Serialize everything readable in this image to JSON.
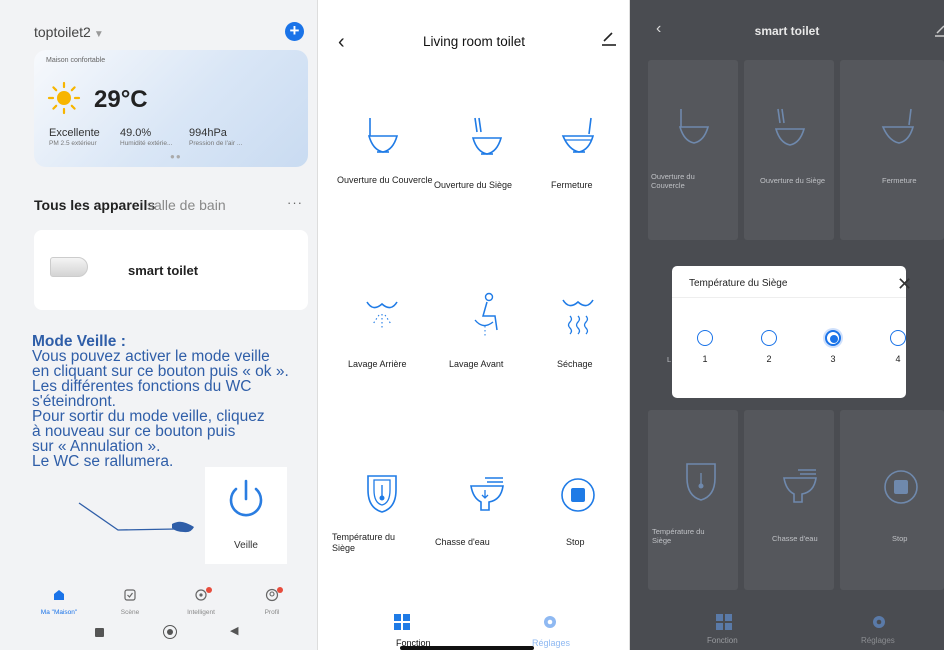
{
  "left": {
    "home_name": "toptoilet2",
    "weather": {
      "location_label": "Maison confortable",
      "temperature": "29°C",
      "air_quality": "Excellente",
      "air_quality_sub": "PM 2.5 extérieur",
      "humidity": "49.0%",
      "humidity_sub": "Humidité extérie...",
      "pressure": "994hPa",
      "pressure_sub": "Pression de l'air ..."
    },
    "all_devices": "Tous les appareils",
    "room": "salle de bain",
    "more": "···",
    "device_name": "smart toilet",
    "help_title": "Mode Veille :",
    "help_lines": [
      "Vous pouvez activer le mode veille",
      "en cliquant sur ce bouton puis « ok ».",
      "Les différentes fonctions du WC",
      "s'éteindront.",
      "Pour sortir du mode veille, cliquez",
      "à nouveau sur ce bouton puis",
      "sur « Annulation ».",
      "Le WC se rallumera."
    ],
    "veille_label": "Veille",
    "tabs": [
      "Ma \"Maison\"",
      "Scène",
      "Intelligent",
      "Profil"
    ],
    "accent": "#1a73e8",
    "help_color": "#2f5ea8"
  },
  "middle": {
    "title": "Living room toilet",
    "functions": [
      "Ouverture du Couvercle",
      "Ouverture du Siège",
      "Fermeture",
      "Lavage Arrière",
      "Lavage Avant",
      "Séchage",
      "Température du Siège",
      "Chasse d'eau",
      "Stop"
    ],
    "tab_function": "Fonction",
    "tab_settings": "Réglages"
  },
  "right": {
    "title": "smart toilet",
    "functions": {
      "f1": "Ouverture du Couvercle",
      "f2": "Ouverture du Siège",
      "f3": "Fermeture",
      "f4": "L",
      "f7": "Température du Siège",
      "f8": "Chasse d'eau",
      "f9": "Stop"
    },
    "modal": {
      "title": "Température du Siège",
      "options": [
        "1",
        "2",
        "3",
        "4"
      ],
      "selected": "3"
    },
    "tab_function": "Fonction",
    "tab_settings": "Réglages"
  }
}
